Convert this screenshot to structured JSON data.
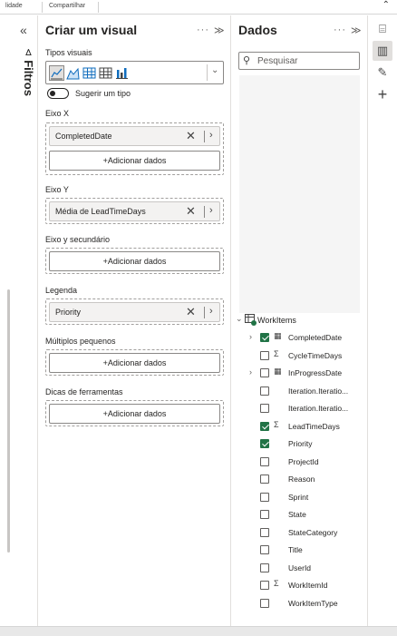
{
  "topbar": {
    "tab1": "lidade",
    "tab2": "Compartilhar",
    "collapse_icon": "caret-up-icon"
  },
  "filters": {
    "title": "Filtros",
    "collapse_icon": "double-chevron-left-icon"
  },
  "viz": {
    "title": "Criar um visual",
    "more": "···",
    "expand": "≫",
    "tipos_label": "Tipos visuais",
    "suggest_label": "Sugerir um tipo",
    "eixo_x": {
      "label": "Eixo X",
      "field": "CompletedDate",
      "add": "+Adicionar dados"
    },
    "eixo_y": {
      "label": "Eixo Y",
      "field": "Média de LeadTimeDays"
    },
    "eixo_y2": {
      "label": "Eixo y secundário",
      "add": "+Adicionar dados"
    },
    "legenda": {
      "label": "Legenda",
      "field": "Priority"
    },
    "multiplos": {
      "label": "Múltiplos pequenos",
      "add": "+Adicionar dados"
    },
    "dicas": {
      "label": "Dicas de ferramentas",
      "add": "+Adicionar dados"
    }
  },
  "data": {
    "title": "Dados",
    "more": "···",
    "expand": "≫",
    "search_placeholder": "Pesquisar",
    "table": "WorkItems",
    "fields": [
      {
        "name": "CompletedDate",
        "checked": true,
        "type": "date",
        "expandable": true
      },
      {
        "name": "CycleTimeDays",
        "checked": false,
        "type": "sum",
        "expandable": false
      },
      {
        "name": "InProgressDate",
        "checked": false,
        "type": "date",
        "expandable": true
      },
      {
        "name": "Iteration.Iteratio...",
        "checked": false,
        "type": "",
        "expandable": false
      },
      {
        "name": "Iteration.Iteratio...",
        "checked": false,
        "type": "",
        "expandable": false
      },
      {
        "name": "LeadTimeDays",
        "checked": true,
        "type": "sum",
        "expandable": false
      },
      {
        "name": "Priority",
        "checked": true,
        "type": "",
        "expandable": false
      },
      {
        "name": "ProjectId",
        "checked": false,
        "type": "",
        "expandable": false
      },
      {
        "name": "Reason",
        "checked": false,
        "type": "",
        "expandable": false
      },
      {
        "name": "Sprint",
        "checked": false,
        "type": "",
        "expandable": false
      },
      {
        "name": "State",
        "checked": false,
        "type": "",
        "expandable": false
      },
      {
        "name": "StateCategory",
        "checked": false,
        "type": "",
        "expandable": false
      },
      {
        "name": "Title",
        "checked": false,
        "type": "",
        "expandable": false
      },
      {
        "name": "UserId",
        "checked": false,
        "type": "",
        "expandable": false
      },
      {
        "name": "WorkItemId",
        "checked": false,
        "type": "sum",
        "expandable": false
      },
      {
        "name": "WorkItemType",
        "checked": false,
        "type": "",
        "expandable": false
      }
    ]
  },
  "colors": {
    "accent": "#217346",
    "border": "#8a8886"
  }
}
